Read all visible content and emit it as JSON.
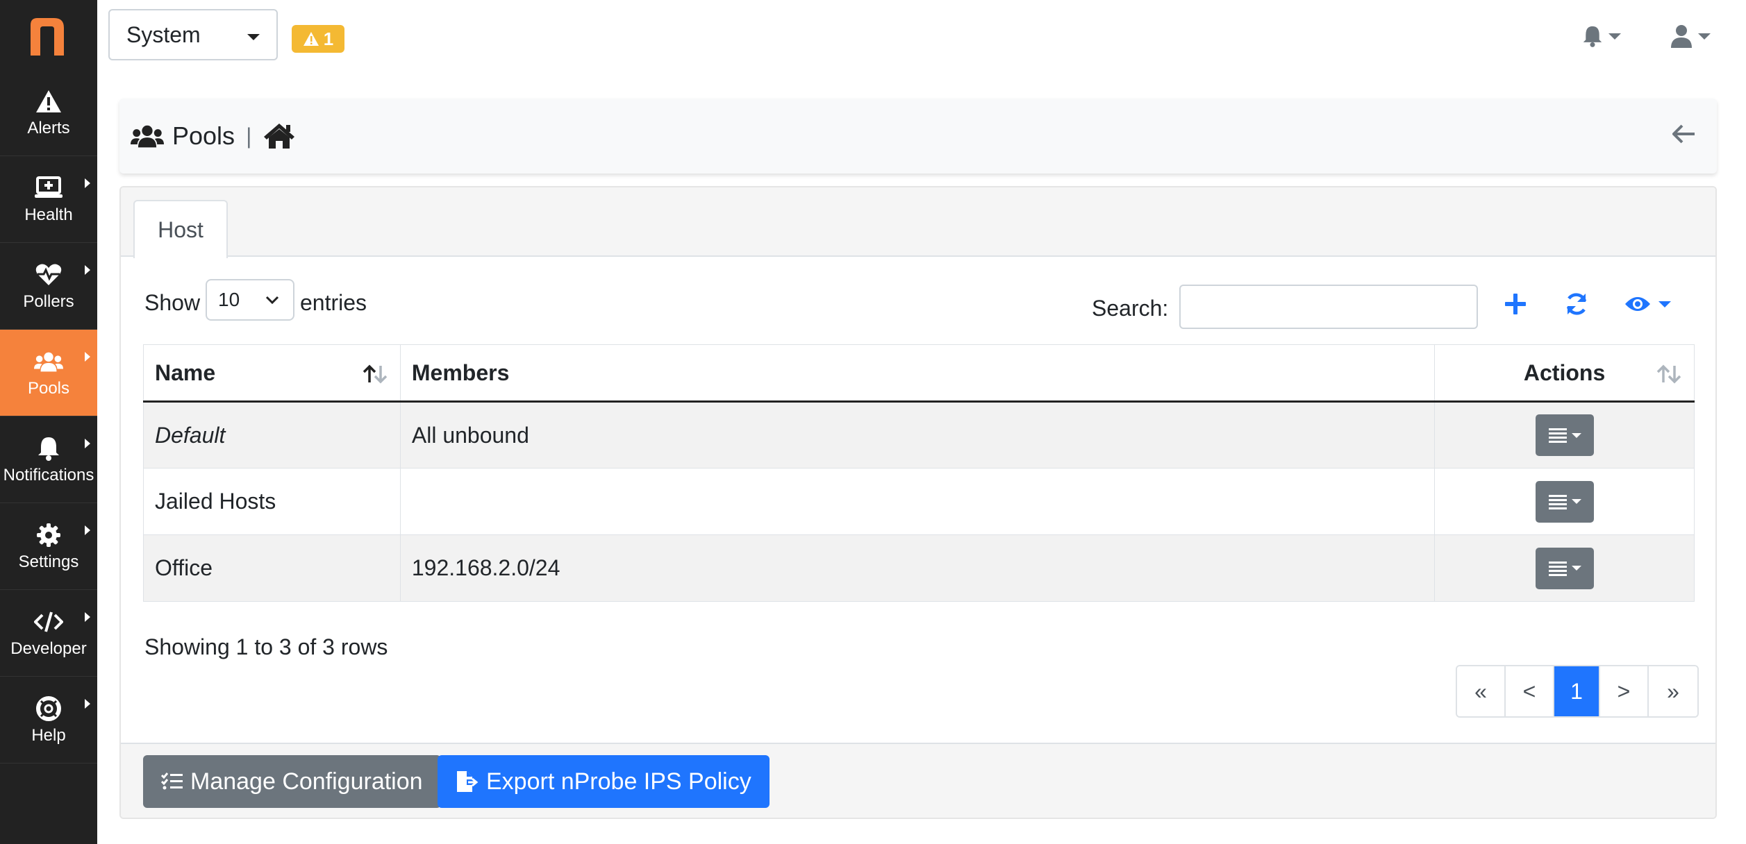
{
  "sidebar": {
    "items": [
      {
        "label": "Alerts",
        "icon": "warning-icon"
      },
      {
        "label": "Health",
        "icon": "monitor-plus-icon"
      },
      {
        "label": "Pollers",
        "icon": "heartbeat-icon"
      },
      {
        "label": "Pools",
        "icon": "users-icon"
      },
      {
        "label": "Notifications",
        "icon": "bell-icon"
      },
      {
        "label": "Settings",
        "icon": "gear-icon"
      },
      {
        "label": "Developer",
        "icon": "code-icon"
      },
      {
        "label": "Help",
        "icon": "life-ring-icon"
      }
    ],
    "active": "Pools"
  },
  "topbar": {
    "interface_selected": "System",
    "alert_count": "1"
  },
  "header": {
    "title": "Pools",
    "separator": "|"
  },
  "tabs": [
    {
      "label": "Host"
    }
  ],
  "controls": {
    "show_label": "Show",
    "page_length": "10",
    "entries_label": "entries",
    "search_label": "Search:",
    "search_value": ""
  },
  "table": {
    "columns": [
      "Name",
      "Members",
      "Actions"
    ],
    "rows": [
      {
        "name": "Default",
        "members": "All unbound"
      },
      {
        "name": "Jailed Hosts",
        "members": ""
      },
      {
        "name": "Office",
        "members": "192.168.2.0/24"
      }
    ]
  },
  "footer_info": "Showing 1 to 3 of 3 rows",
  "pagination": {
    "first": "«",
    "prev": "<",
    "current": "1",
    "next": ">",
    "last": "»"
  },
  "buttons": {
    "manage": "Manage Configuration",
    "export": "Export nProbe IPS Policy"
  },
  "colors": {
    "sidebar_bg": "#222222",
    "accent_orange": "#f5823c",
    "primary_blue": "#1f75fe",
    "secondary_gray": "#6c757d",
    "warning_yellow": "#f4b933"
  }
}
